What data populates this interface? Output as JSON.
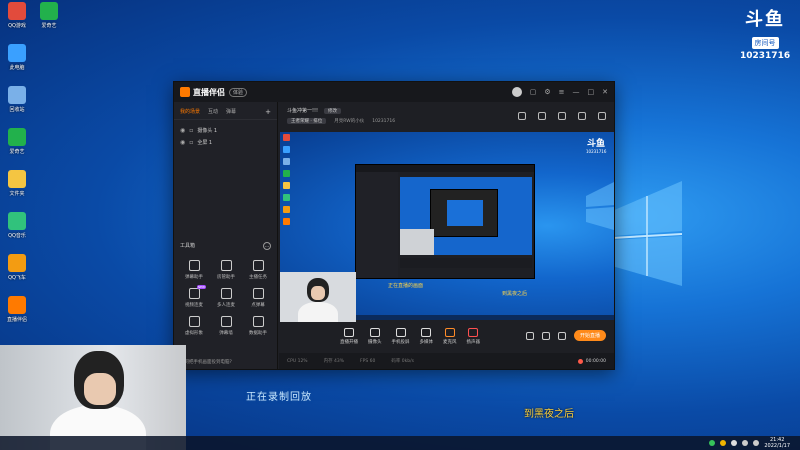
{
  "desktop": {
    "icons": [
      {
        "label": "QQ游戏",
        "color": "#e24b3c"
      },
      {
        "label": "此电脑",
        "color": "#3aa0ff"
      },
      {
        "label": "回收站",
        "color": "#7ab0e8"
      },
      {
        "label": "爱奇艺",
        "color": "#22b14c"
      },
      {
        "label": "文件夹",
        "color": "#f4c542"
      },
      {
        "label": "QQ音乐",
        "color": "#31c27c"
      },
      {
        "label": "QQ飞车",
        "color": "#f39c12"
      },
      {
        "label": "直播伴侣",
        "color": "#ff7a00"
      }
    ],
    "icons_col2": [
      {
        "label": "爱奇艺",
        "color": "#22b14c"
      }
    ]
  },
  "room_badge": {
    "brand": "斗鱼",
    "label": "房间号",
    "number": "10231716"
  },
  "app": {
    "title": "直播伴侣",
    "version": "体验",
    "left_panel": {
      "tabs": [
        "我的场景",
        "互动",
        "弹幕"
      ],
      "scenes": [
        "摄像头 1",
        "全屏 1"
      ],
      "tools_title": "工具箱",
      "tools": [
        {
          "label": "弹幕助手",
          "new": false
        },
        {
          "label": "房管助手",
          "new": false
        },
        {
          "label": "主播任务",
          "new": false
        },
        {
          "label": "视频连麦",
          "new": true
        },
        {
          "label": "多人连麦",
          "new": false
        },
        {
          "label": "点弹幕",
          "new": false
        },
        {
          "label": "虚拟形象",
          "new": false
        },
        {
          "label": "弹幕墙",
          "new": false
        },
        {
          "label": "数据助手",
          "new": false
        }
      ],
      "bottom_text": "如何把手机画面投到电脑?"
    },
    "stream": {
      "room_title": "斗鱼冲第一!!!",
      "edit_tag": "修改",
      "category": "王者荣耀 · 排位",
      "streamer": "月亮RW的小伙",
      "room_id": "10231716"
    },
    "controls": [
      "直播开播",
      "摄像头",
      "手机投屏",
      "多媒体",
      "麦克风",
      "扬声器"
    ],
    "live_button": "开始直播",
    "status": {
      "items": [
        "CPU 12%",
        "内存 43%",
        "FPS 60",
        "码率 0kb/s"
      ],
      "timer": "00:00:00"
    }
  },
  "preview": {
    "caption_left": "正在直播的画面",
    "caption_right": "到黑夜之后"
  },
  "subtitles": {
    "left": "正在录制回放",
    "right": "到黑夜之后"
  },
  "taskbar": {
    "time": "21:42",
    "date": "2022/1/17"
  }
}
